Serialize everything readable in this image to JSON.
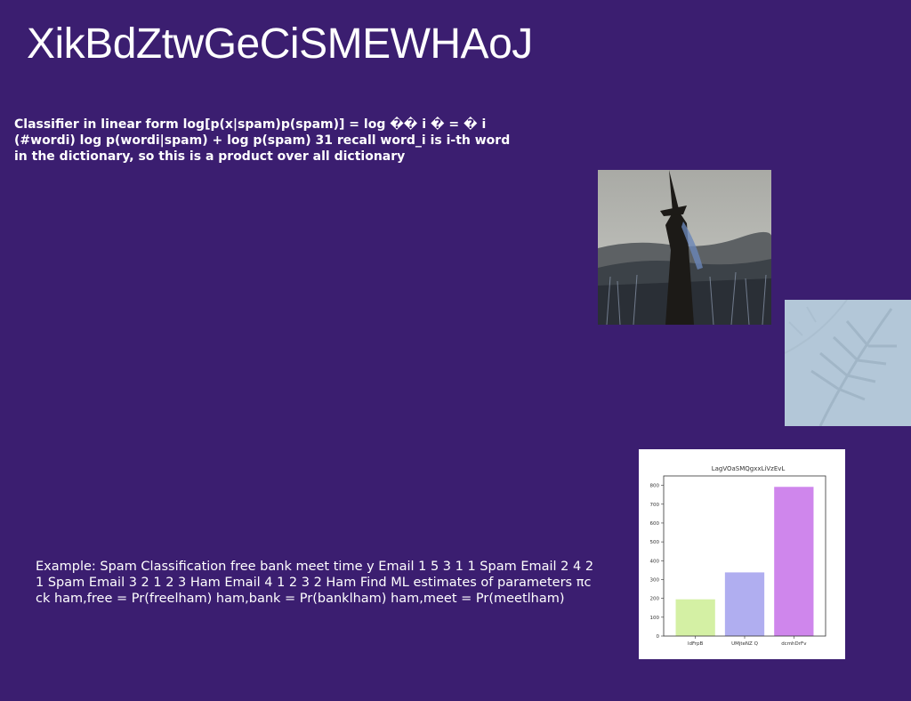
{
  "title": "XikBdZtwGeCiSMEWHAoJ",
  "classifier_text": "Classifier in linear form log[p(x|spam)p(spam)] = log �� i � = � i (#wordi) log p(wordi|spam) + log p(spam) 31 recall word_i is i-th word in the dictionary, so this is a product over all dictionary",
  "example_text": "Example: Spam Classification free bank meet time y Email 1 5 3 1 1 Spam Email 2 4 2 1 Spam Email 3 2 1 2 3 Ham Email 4 1 2 3 2 Ham Find ML estimates of parameters πc ck ham,free = Pr(freelham) ham,bank = Pr(banklham) ham,meet = Pr(meetlham)",
  "images": {
    "witch_photo_icon": "witch-silhouette-photo",
    "leaf_photo_icon": "fern-shadow-photo"
  },
  "chart_data": {
    "type": "bar",
    "title": "LagVOaSMQgxxLiVzEvL",
    "categories": [
      "ldFrpB",
      "UMjteNZ Q",
      "dcmhDrFv"
    ],
    "values": [
      195,
      338,
      792
    ],
    "colors": [
      "#d4f0a4",
      "#b0aef0",
      "#cf86ec"
    ],
    "ylim": [
      0,
      850
    ],
    "yticks": [
      0,
      100,
      200,
      300,
      400,
      500,
      600,
      700,
      800
    ],
    "xlabel": "",
    "ylabel": "",
    "grid": false
  }
}
